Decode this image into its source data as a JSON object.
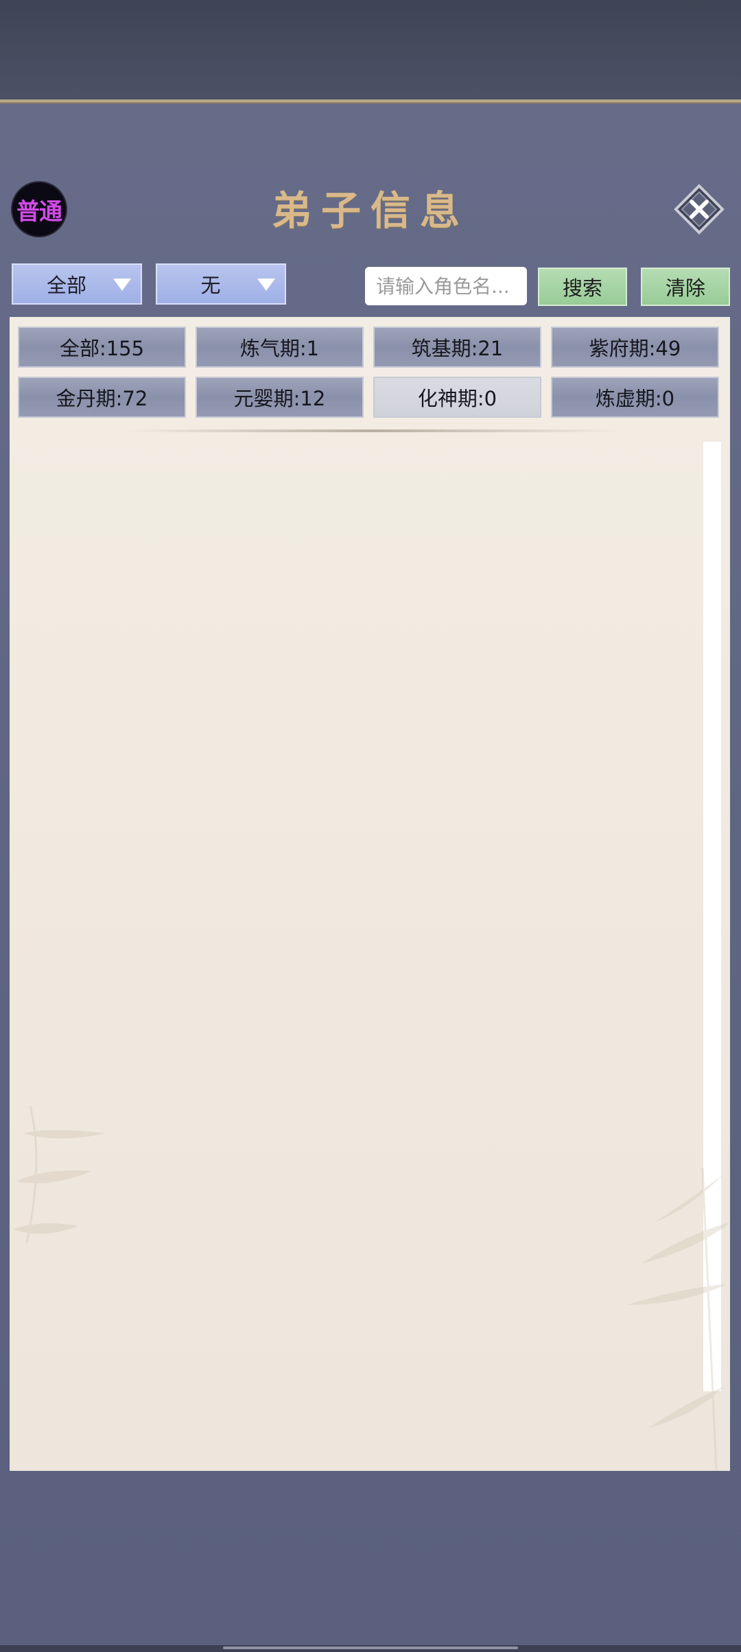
{
  "header": {
    "badge_label": "普通",
    "title": "弟子信息",
    "close_icon": "close-icon"
  },
  "filters": {
    "dropdown1": {
      "value": "全部"
    },
    "dropdown2": {
      "value": "无"
    },
    "search": {
      "placeholder": "请输入角色名..."
    },
    "search_button": "搜索",
    "clear_button": "清除"
  },
  "tabs": [
    {
      "label": "全部:155"
    },
    {
      "label": "炼气期:1"
    },
    {
      "label": "筑基期:21"
    },
    {
      "label": "紫府期:49"
    },
    {
      "label": "金丹期:72"
    },
    {
      "label": "元婴期:12"
    },
    {
      "label": "化神期:0"
    },
    {
      "label": "炼虚期:0"
    }
  ],
  "colors": {
    "frame": "#5f6683",
    "panel": "#efe9df",
    "title": "#d9b98a",
    "badge_text": "#d24be6",
    "dropdown": "#a9b8ea",
    "green_button": "#a6d4a4"
  }
}
